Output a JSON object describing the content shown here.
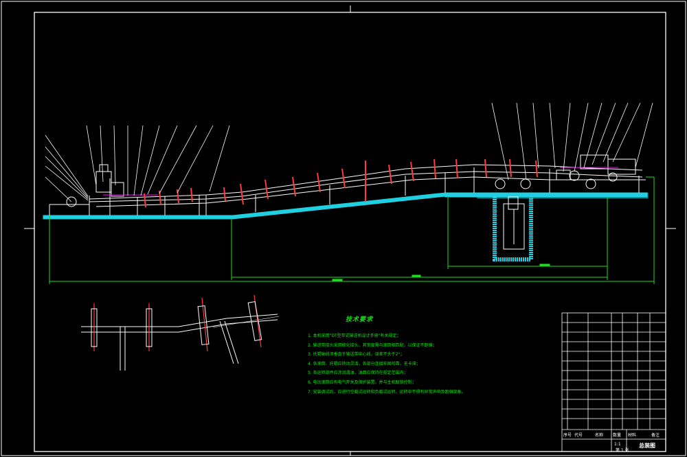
{
  "technical_notes": {
    "title": "技术要求",
    "items": [
      "1. 本机采用\"DT型带式输送机设计手册\"有关规定；",
      "2. 输送带接头采用硫化接头，其宽度需与滚筒相匹配，以保证不跑偏；",
      "3. 托辊轴线须垂直于输送带中心线，误差不大于2°；",
      "4. 各滚筒、托辊应转动灵活，各部分连接牢固可靠，无卡滞；",
      "5. 各运转部件应涂润滑油，油面应保持在规定范围内；",
      "6. 电动滚筒应有电气开关及保护装置，并与主机联锁控制；",
      "7. 安装调试后，应进行空载试运转和负载试运转，运转中不得有异常声响及跑偏现象。"
    ]
  },
  "title_block": {
    "header_labels": [
      "序号",
      "代号",
      "名称",
      "数量",
      "材料",
      "备注"
    ],
    "drawing_name": "总装图",
    "scale_label": "1:1",
    "sheet_label": "第 1 张"
  },
  "colors": {
    "line": "#ffffff",
    "ground": "#20d0e0",
    "dimension": "#18e018",
    "belt": "#ff3b3b",
    "accent": "#ff00ff"
  }
}
